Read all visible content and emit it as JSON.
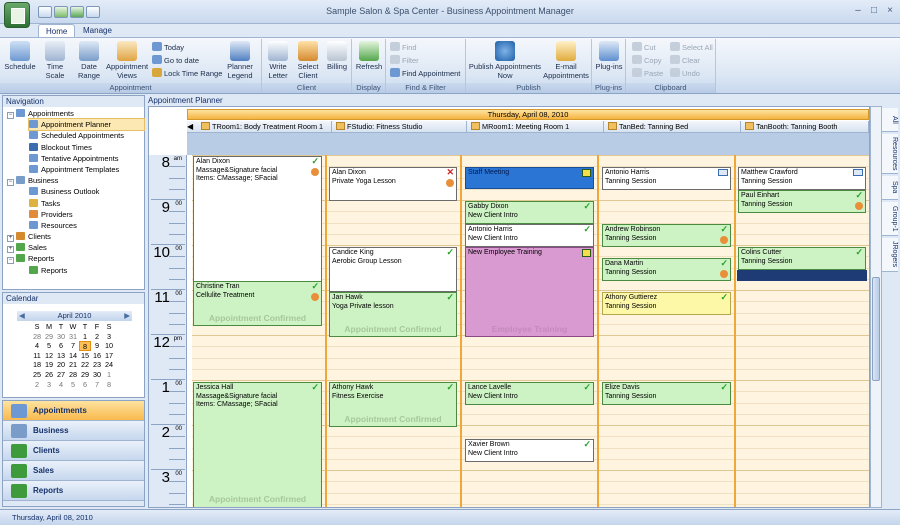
{
  "window": {
    "title": "Sample Salon & Spa Center - Business Appointment Manager"
  },
  "tabs": [
    "Home",
    "Manage"
  ],
  "ribbon": {
    "schedule": {
      "label": "Schedule",
      "sub": ""
    },
    "time_scale": {
      "label": "Time",
      "sub": "Scale"
    },
    "date_range": {
      "label": "Date",
      "sub": "Range"
    },
    "appt_views": {
      "label": "Appointment",
      "sub": "Views"
    },
    "today": "Today",
    "go_to_date": "Go to date",
    "lock_time_range": "Lock Time Range",
    "planner_legend": {
      "label": "Planner",
      "sub": "Legend"
    },
    "group_appointment": "Appointment",
    "write_letter": {
      "label": "Write",
      "sub": "Letter"
    },
    "select_client": {
      "label": "Select",
      "sub": "Client"
    },
    "billing": "Billing",
    "group_client": "Client",
    "refresh": "Refresh",
    "group_display": "Display",
    "find": "Find",
    "filter": "Filter",
    "find_appointment": "Find Appointment",
    "group_find": "Find & Filter",
    "publish_now": {
      "label": "Publish Appointments",
      "sub": "Now"
    },
    "email_appts": {
      "label": "E-mail",
      "sub": "Appointments"
    },
    "group_publish": "Publish",
    "plugins": "Plug-ins",
    "group_plugins": "Plug-ins",
    "cut": "Cut",
    "copy": "Copy",
    "paste": "Paste",
    "select_all": "Select All",
    "clear": "Clear",
    "undo": "Undo",
    "group_clipboard": "Clipboard"
  },
  "navigation": {
    "title": "Navigation",
    "appointments": "Appointments",
    "appt_items": [
      "Appointment Planner",
      "Scheduled Appointments",
      "Blockout Times",
      "Tentative Appointments",
      "Appointment Templates"
    ],
    "business": "Business",
    "business_items": [
      "Business Outlook",
      "Tasks",
      "Providers",
      "Resources"
    ],
    "clients": "Clients",
    "sales": "Sales",
    "reports": "Reports",
    "reports_items": [
      "Reports"
    ]
  },
  "calendar": {
    "title": "Calendar",
    "month": "April 2010",
    "dow": [
      "S",
      "M",
      "T",
      "W",
      "T",
      "F",
      "S"
    ],
    "weeks": [
      [
        "28",
        "29",
        "30",
        "31",
        "1",
        "2",
        "3"
      ],
      [
        "4",
        "5",
        "6",
        "7",
        "8",
        "9",
        "10"
      ],
      [
        "11",
        "12",
        "13",
        "14",
        "15",
        "16",
        "17"
      ],
      [
        "18",
        "19",
        "20",
        "21",
        "22",
        "23",
        "24"
      ],
      [
        "25",
        "26",
        "27",
        "28",
        "29",
        "30",
        "1"
      ],
      [
        "2",
        "3",
        "4",
        "5",
        "6",
        "7",
        "8"
      ]
    ],
    "today": "8"
  },
  "outlook": [
    "Appointments",
    "Business",
    "Clients",
    "Sales",
    "Reports"
  ],
  "status": "Thursday, April 08, 2010",
  "planner": {
    "title": "Appointment Planner",
    "date": "Thursday, April 08, 2010",
    "rooms": [
      "TRoom1: Body Treatment Room 1",
      "FStudio: Fitness Studio",
      "MRoom1: Meeting Room 1",
      "TanBed: Tanning Bed",
      "TanBooth: Tanning Booth"
    ],
    "hours": [
      {
        "h": "8",
        "m": "am"
      },
      {
        "h": "9",
        "m": "00"
      },
      {
        "h": "10",
        "m": "00"
      },
      {
        "h": "11",
        "m": "00"
      },
      {
        "h": "12",
        "m": "pm"
      },
      {
        "h": "1",
        "m": "00"
      },
      {
        "h": "2",
        "m": "00"
      },
      {
        "h": "3",
        "m": "00"
      }
    ],
    "side_tabs": [
      "All",
      "Resources",
      "Spa",
      "Group-1",
      "JRogers"
    ]
  },
  "appts": {
    "a1": {
      "l1": "Alan Dixon",
      "l2": "Massage&Signature facial",
      "l3": "Items: CMassage; SFacial"
    },
    "a2": {
      "l1": "Christine Tran",
      "l2": "Cellulite Treatment",
      "wm": "Appointment Confirmed"
    },
    "a3": {
      "l1": "Jessica Hall",
      "l2": "Massage&Signature facial",
      "l3": "Items: CMassage; SFacial",
      "wm": "Appointment Confirmed"
    },
    "b1": {
      "l1": "Alan Dixon",
      "l2": "Private Yoga Lesson"
    },
    "b2": {
      "l1": "Candice King",
      "l2": "Aerobic Group Lesson"
    },
    "b3": {
      "l1": "Jan Hawk",
      "l2": "Yoga Private lesson",
      "wm": "Appointment Confirmed"
    },
    "b4": {
      "l1": "Athony Hawk",
      "l2": "Fitness Exercise",
      "wm": "Appointment Confirmed"
    },
    "c1": {
      "l1": "Staff Meeting"
    },
    "c2": {
      "l1": "Gabby Dixon",
      "l2": "New Client Intro"
    },
    "c3": {
      "l1": "Antonio Harris",
      "l2": "New Client Intro"
    },
    "c4": {
      "l1": "New Employee Training",
      "wm": "Employee Training"
    },
    "c5": {
      "l1": "Lance Lavelle",
      "l2": "New Client Intro"
    },
    "c6": {
      "l1": "Xavier Brown",
      "l2": "New Client Intro"
    },
    "d1": {
      "l1": "Antonio Harris",
      "l2": "Tanning Session"
    },
    "d2": {
      "l1": "Andrew Robinson",
      "l2": "Tanning Session"
    },
    "d3": {
      "l1": "Dana Martin",
      "l2": "Tanning Session"
    },
    "d4": {
      "l1": "Athony Guttierez",
      "l2": "Tanning Session"
    },
    "d5": {
      "l1": "Elize Davis",
      "l2": "Tanning Session"
    },
    "e1": {
      "l1": "Matthew Crawford",
      "l2": "Tanning Session"
    },
    "e2": {
      "l1": "Paul Einhart",
      "l2": "Tanning Session"
    },
    "e3": {
      "l1": "Colins Cutter",
      "l2": "Tanning Session"
    }
  }
}
